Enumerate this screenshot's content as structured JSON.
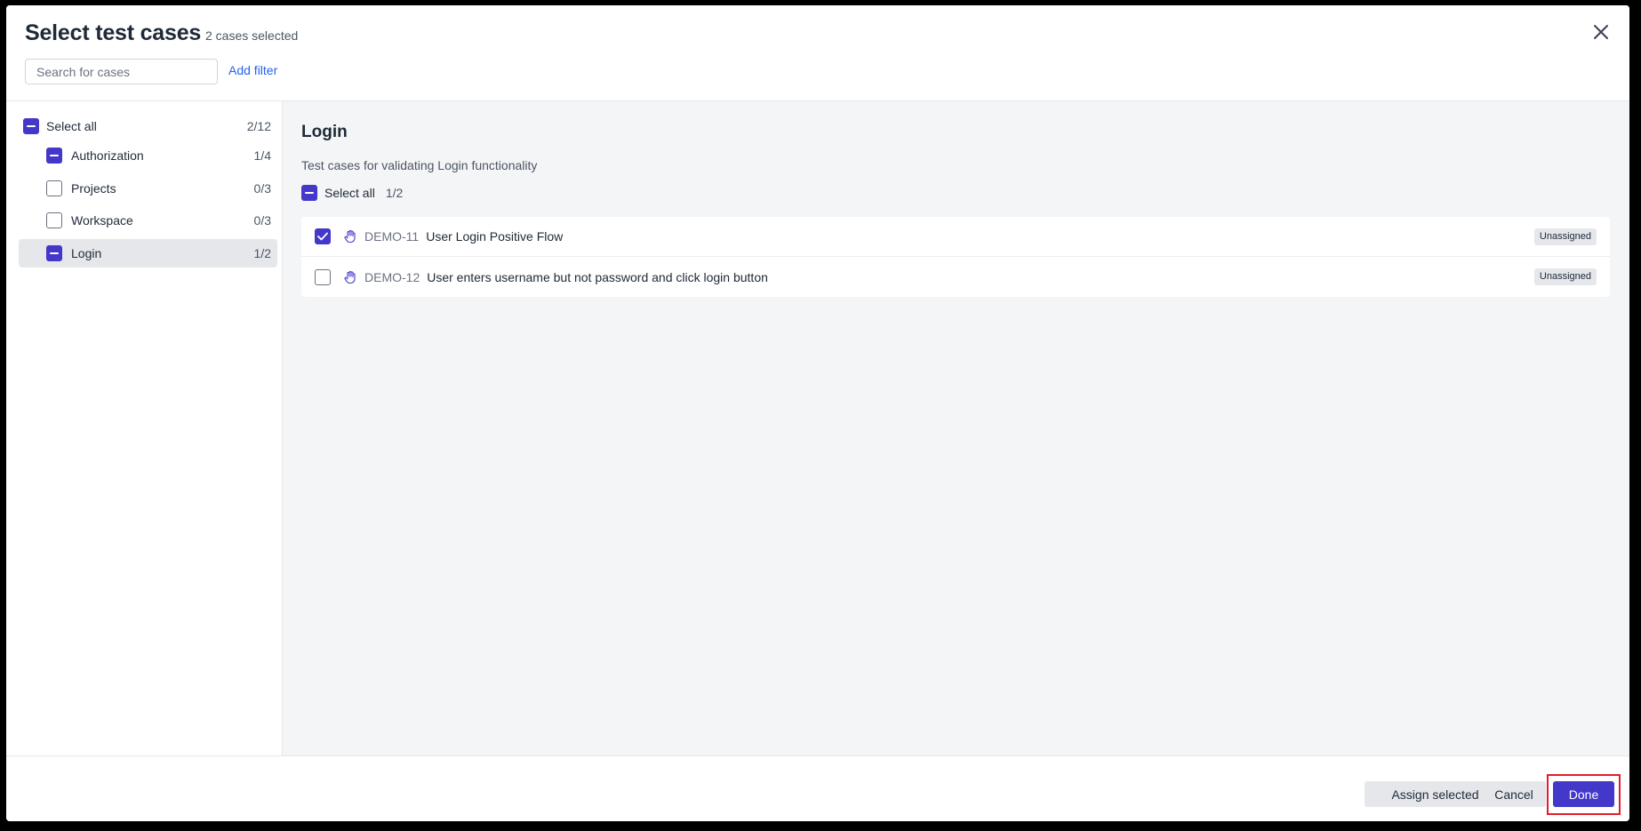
{
  "header": {
    "title": "Select test cases",
    "selected_count": "2 cases selected",
    "search_placeholder": "Search for cases",
    "add_filter": "Add filter",
    "close_icon": "close-icon"
  },
  "sidebar": {
    "select_all": {
      "label": "Select all",
      "count": "2/12",
      "state": "indeterminate"
    },
    "items": [
      {
        "label": "Authorization",
        "count": "1/4",
        "state": "indeterminate"
      },
      {
        "label": "Projects",
        "count": "0/3",
        "state": "empty"
      },
      {
        "label": "Workspace",
        "count": "0/3",
        "state": "empty"
      },
      {
        "label": "Login",
        "count": "1/2",
        "state": "indeterminate",
        "active": true
      }
    ]
  },
  "main": {
    "section_title": "Login",
    "section_description": "Test cases for validating Login functionality",
    "select_all": {
      "label": "Select all",
      "count": "1/2",
      "state": "indeterminate"
    },
    "cases": [
      {
        "id": "DEMO-11",
        "title": "User Login Positive Flow",
        "status": "Unassigned",
        "checked": true,
        "icon": "manual-hand-icon"
      },
      {
        "id": "DEMO-12",
        "title": "User enters username but not password and click login button",
        "status": "Unassigned",
        "checked": false,
        "icon": "manual-hand-icon"
      }
    ]
  },
  "footer": {
    "assign_selected": "Assign selected",
    "cancel": "Cancel",
    "done": "Done"
  },
  "colors": {
    "accent": "#4338ca",
    "link": "#2563eb",
    "highlight": "#e11d2a"
  }
}
